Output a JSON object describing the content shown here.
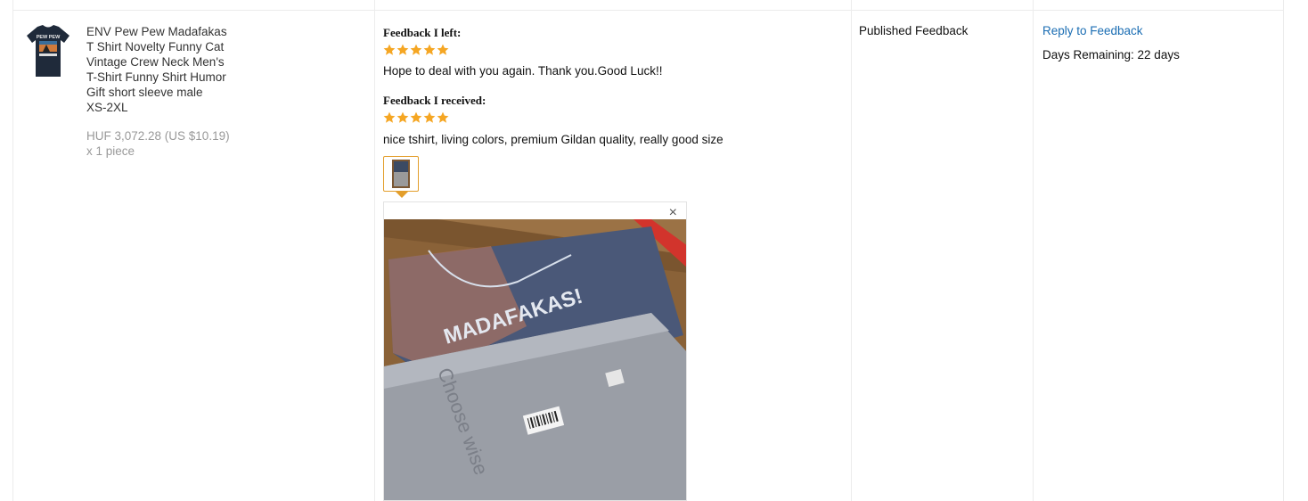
{
  "product": {
    "title_lines": [
      "ENV Pew Pew Madafakas",
      "T Shirt Novelty Funny Cat",
      "Vintage Crew Neck Men's",
      "T-Shirt Funny Shirt Humor",
      "Gift short sleeve male",
      "XS-2XL"
    ],
    "price": "HUF 3,072.28 (US $10.19)",
    "quantity": "x 1 piece",
    "thumbnail_text": "PEW PEW"
  },
  "feedback_left": {
    "heading": "Feedback I left:",
    "stars": 5,
    "text": "Hope to deal with you again. Thank you.Good Luck!!"
  },
  "feedback_received": {
    "heading": "Feedback I received:",
    "stars": 5,
    "text": "nice tshirt, living colors, premium Gildan quality, really good size"
  },
  "photo": {
    "close_label": "×",
    "print_text": "MADAFAKAS!",
    "bag_text": "Choose wise"
  },
  "status": {
    "label": "Published Feedback"
  },
  "actions": {
    "reply_label": "Reply to Feedback",
    "days_remaining": "Days Remaining: 22 days"
  },
  "colors": {
    "star": "#f5a623",
    "link": "#1a6db3",
    "thumb_border": "#e39e2b"
  }
}
